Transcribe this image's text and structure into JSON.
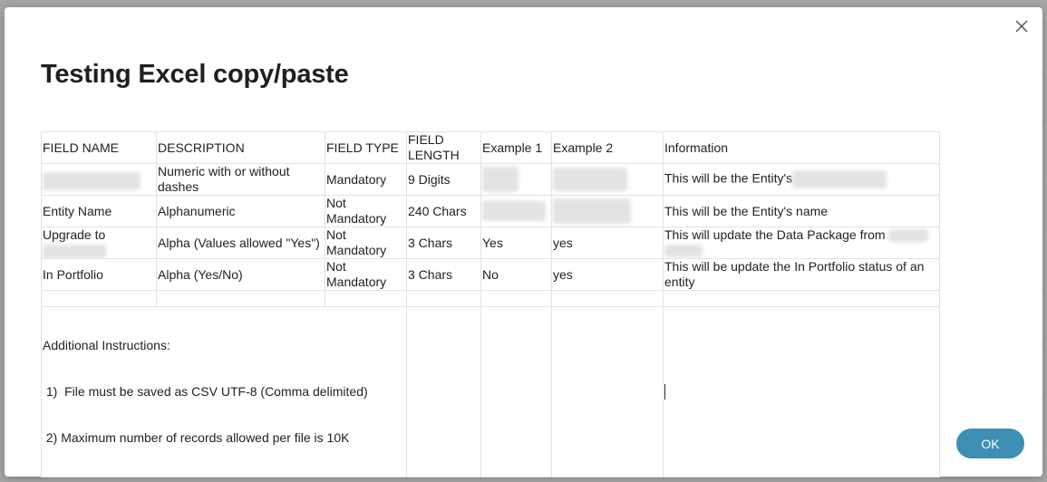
{
  "dialog": {
    "title": "Testing Excel copy/paste",
    "ok_label": "OK",
    "close_icon": "close-icon"
  },
  "table": {
    "headers": [
      "FIELD NAME",
      "DESCRIPTION",
      "FIELD TYPE",
      "FIELD LENGTH",
      "Example 1",
      "Example 2",
      "Information"
    ],
    "rows": [
      {
        "field_name": "",
        "description": "Numeric with or without dashes",
        "field_type": "Mandatory",
        "field_length": "9 Digits",
        "example1": "",
        "example2": "",
        "information": "This will be the Entity's"
      },
      {
        "field_name": "Entity Name",
        "description": "Alphanumeric",
        "field_type": "Not Mandatory",
        "field_length": "240 Chars",
        "example1": "",
        "example2": "",
        "information": "This will be the Entity's name"
      },
      {
        "field_name": "Upgrade to",
        "description": "Alpha (Values allowed \"Yes\")",
        "field_type": "Not Mandatory",
        "field_length": "3 Chars",
        "example1": "Yes",
        "example2": "yes",
        "information": "This will update the Data Package from"
      },
      {
        "field_name": "In Portfolio",
        "description": "Alpha (Yes/No)",
        "field_type": "Not Mandatory",
        "field_length": "3 Chars",
        "example1": "No",
        "example2": "yes",
        "information": "This will be update the In Portfolio status of an entity"
      }
    ],
    "instructions": {
      "heading": "Additional Instructions:",
      "line1": " 1)  File must be saved as CSV UTF-8 (Comma delimited)",
      "line2": " 2) Maximum number of records allowed per file is 10K"
    }
  }
}
